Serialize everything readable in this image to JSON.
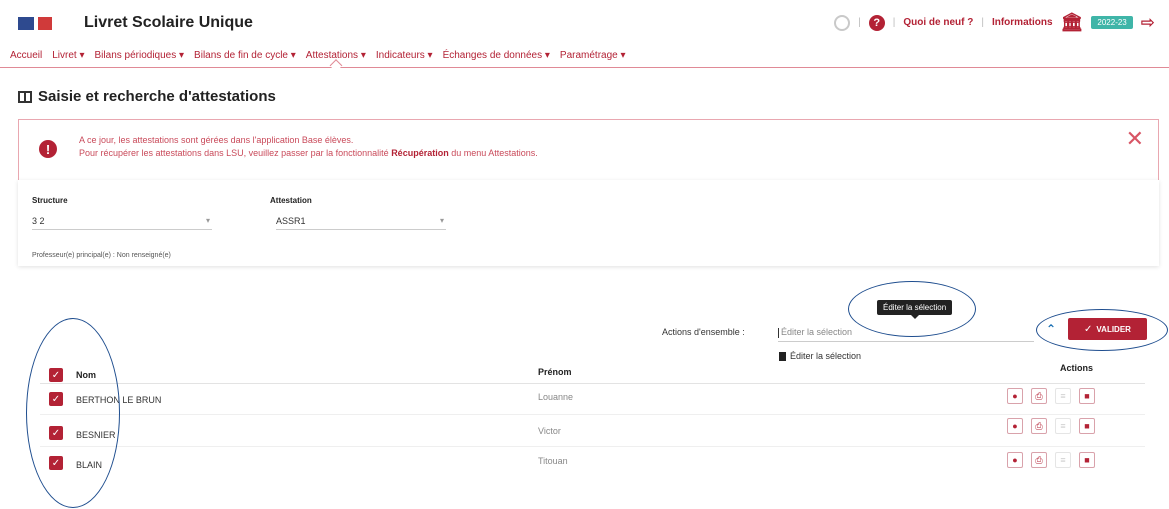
{
  "app": {
    "title": "Livret Scolaire Unique",
    "header_links": [
      "Quoi de neuf ?",
      "Informations"
    ],
    "year_badge": "2022-23"
  },
  "nav": {
    "items": [
      {
        "label": "Accueil",
        "active": false
      },
      {
        "label": "Livret ▾",
        "active": false
      },
      {
        "label": "Bilans périodiques ▾",
        "active": false
      },
      {
        "label": "Bilans de fin de cycle ▾",
        "active": false
      },
      {
        "label": "Attestations ▾",
        "active": true
      },
      {
        "label": "Indicateurs ▾",
        "active": false
      },
      {
        "label": "Échanges de données ▾",
        "active": false
      },
      {
        "label": "Paramétrage ▾",
        "active": false
      }
    ]
  },
  "page": {
    "title": "Saisie et recherche d'attestations"
  },
  "alert": {
    "line1": "A ce jour, les attestations sont gérées dans l'application Base élèves.",
    "line2_before": "Pour récupérer les attestations dans LSU, veuillez passer par la fonctionnalité",
    "line2_bold": "Récupération",
    "line2_after": "du menu Attestations."
  },
  "filters": {
    "structure_label": "Structure",
    "structure_value": "3 2",
    "attestation_label": "Attestation",
    "attestation_value": "ASSR1",
    "prof_note": "Professeur(e) principal(e) : Non renseigné(e)"
  },
  "actions": {
    "label": "Actions d'ensemble :",
    "select_value": "Éditer la sélection",
    "option": "Éditer la sélection",
    "tooltip": "Éditer la sélection",
    "submit_label": "VALIDER"
  },
  "table": {
    "headers": {
      "nom": "Nom",
      "prenom": "Prénom",
      "actions": "Actions"
    },
    "rows": [
      {
        "nom": "BERTHON LE BRUN",
        "prenom": "Louanne"
      },
      {
        "nom": "BESNIER",
        "prenom": "Victor"
      },
      {
        "nom": "BLAIN",
        "prenom": "Titouan"
      }
    ]
  },
  "colors": {
    "accent": "#b32235",
    "annotation": "#1f4e8f"
  }
}
